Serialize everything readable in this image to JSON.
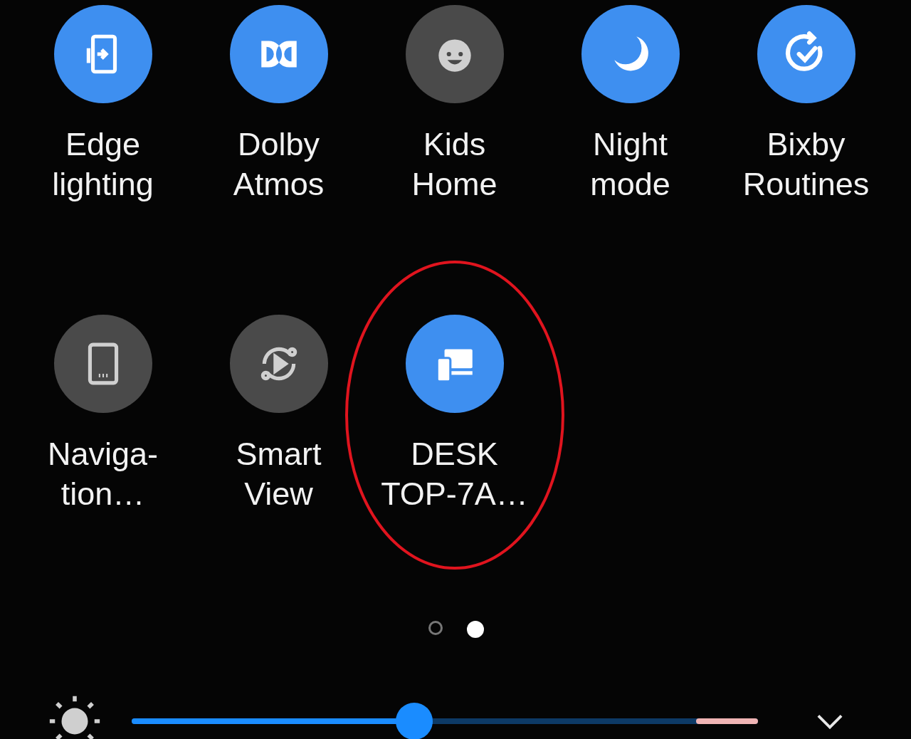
{
  "tiles": [
    {
      "label_lines": [
        "Edge",
        "lighting"
      ],
      "on": true,
      "kind": "edge",
      "highlighted": false
    },
    {
      "label_lines": [
        "Dolby",
        "Atmos"
      ],
      "on": true,
      "kind": "dolby",
      "highlighted": false
    },
    {
      "label_lines": [
        "Kids",
        "Home"
      ],
      "on": false,
      "kind": "kids",
      "highlighted": false
    },
    {
      "label_lines": [
        "Night",
        "mode"
      ],
      "on": true,
      "kind": "moon",
      "highlighted": false
    },
    {
      "label_lines": [
        "Bixby",
        "Routines"
      ],
      "on": true,
      "kind": "routine",
      "highlighted": false
    },
    {
      "label_lines": [
        "Naviga-",
        "tion…"
      ],
      "on": false,
      "kind": "tablet",
      "highlighted": false
    },
    {
      "label_lines": [
        "Smart",
        "View"
      ],
      "on": false,
      "kind": "play",
      "highlighted": false
    },
    {
      "label_lines": [
        "DESK",
        "TOP-7A…"
      ],
      "on": true,
      "kind": "devices",
      "highlighted": true
    }
  ],
  "pages": [
    {
      "selected": false
    },
    {
      "selected": true
    }
  ],
  "brightness": {
    "level": 0.453
  }
}
